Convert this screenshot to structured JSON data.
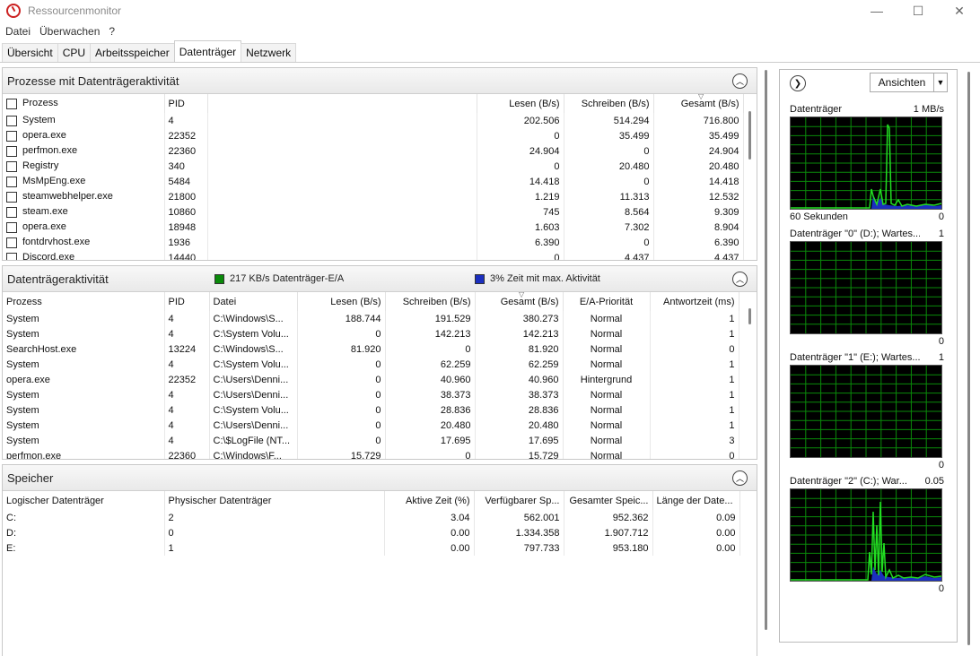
{
  "window": {
    "title": "Ressourcenmonitor",
    "minimize": "—",
    "maximize": "☐",
    "close": "✕"
  },
  "menu": [
    "Datei",
    "Überwachen",
    "?"
  ],
  "tabs": [
    "Übersicht",
    "CPU",
    "Arbeitsspeicher",
    "Datenträger",
    "Netzwerk"
  ],
  "active_tab": "Datenträger",
  "processes": {
    "title": "Prozesse mit Datenträgeraktivität",
    "columns": [
      "Prozess",
      "PID",
      "",
      "Lesen (B/s)",
      "Schreiben (B/s)",
      "Gesamt (B/s)"
    ],
    "rows": [
      [
        "System",
        "4",
        "202.506",
        "514.294",
        "716.800"
      ],
      [
        "opera.exe",
        "22352",
        "0",
        "35.499",
        "35.499"
      ],
      [
        "perfmon.exe",
        "22360",
        "24.904",
        "0",
        "24.904"
      ],
      [
        "Registry",
        "340",
        "0",
        "20.480",
        "20.480"
      ],
      [
        "MsMpEng.exe",
        "5484",
        "14.418",
        "0",
        "14.418"
      ],
      [
        "steamwebhelper.exe",
        "21800",
        "1.219",
        "11.313",
        "12.532"
      ],
      [
        "steam.exe",
        "10860",
        "745",
        "8.564",
        "9.309"
      ],
      [
        "opera.exe",
        "18948",
        "1.603",
        "7.302",
        "8.904"
      ],
      [
        "fontdrvhost.exe",
        "1936",
        "6.390",
        "0",
        "6.390"
      ],
      [
        "Discord.exe",
        "14440",
        "0",
        "4.437",
        "4.437"
      ]
    ]
  },
  "activity": {
    "title": "Datenträgeraktivität",
    "legend_io": "217 KB/s Datenträger-E/A",
    "legend_active": "3% Zeit mit max. Aktivität",
    "color_io": "#0a8a0a",
    "color_active": "#1b2fbf",
    "columns": [
      "Prozess",
      "PID",
      "Datei",
      "Lesen (B/s)",
      "Schreiben (B/s)",
      "Gesamt (B/s)",
      "E/A-Priorität",
      "Antwortzeit (ms)"
    ],
    "rows": [
      [
        "System",
        "4",
        "C:\\Windows\\S...",
        "188.744",
        "191.529",
        "380.273",
        "Normal",
        "1"
      ],
      [
        "System",
        "4",
        "C:\\System Volu...",
        "0",
        "142.213",
        "142.213",
        "Normal",
        "1"
      ],
      [
        "SearchHost.exe",
        "13224",
        "C:\\Windows\\S...",
        "81.920",
        "0",
        "81.920",
        "Normal",
        "0"
      ],
      [
        "System",
        "4",
        "C:\\System Volu...",
        "0",
        "62.259",
        "62.259",
        "Normal",
        "1"
      ],
      [
        "opera.exe",
        "22352",
        "C:\\Users\\Denni...",
        "0",
        "40.960",
        "40.960",
        "Hintergrund",
        "1"
      ],
      [
        "System",
        "4",
        "C:\\Users\\Denni...",
        "0",
        "38.373",
        "38.373",
        "Normal",
        "1"
      ],
      [
        "System",
        "4",
        "C:\\System Volu...",
        "0",
        "28.836",
        "28.836",
        "Normal",
        "1"
      ],
      [
        "System",
        "4",
        "C:\\Users\\Denni...",
        "0",
        "20.480",
        "20.480",
        "Normal",
        "1"
      ],
      [
        "System",
        "4",
        "C:\\$LogFile (NT...",
        "0",
        "17.695",
        "17.695",
        "Normal",
        "3"
      ],
      [
        "perfmon.exe",
        "22360",
        "C:\\Windows\\F...",
        "15.729",
        "0",
        "15.729",
        "Normal",
        "0"
      ]
    ]
  },
  "storage": {
    "title": "Speicher",
    "columns": [
      "Logischer Datenträger",
      "Physischer Datenträger",
      "Aktive Zeit (%)",
      "Verfügbarer Sp...",
      "Gesamter Speic...",
      "Länge der Date..."
    ],
    "rows": [
      [
        "C:",
        "2",
        "3.04",
        "562.001",
        "952.362",
        "0.09"
      ],
      [
        "D:",
        "0",
        "0.00",
        "1.334.358",
        "1.907.712",
        "0.00"
      ],
      [
        "E:",
        "1",
        "0.00",
        "797.733",
        "953.180",
        "0.00"
      ]
    ]
  },
  "right_panel": {
    "view_button": "Ansichten",
    "graphs": [
      {
        "label": "Datenträger",
        "scale": "1 MB/s",
        "bottom_left": "60 Sekunden",
        "bottom_right": "0",
        "activity": "high"
      },
      {
        "label": "Datenträger \"0\" (D:); Wartes...",
        "scale": "1",
        "bottom_left": "",
        "bottom_right": "0",
        "activity": "none"
      },
      {
        "label": "Datenträger \"1\" (E:); Wartes...",
        "scale": "1",
        "bottom_left": "",
        "bottom_right": "0",
        "activity": "none"
      },
      {
        "label": "Datenträger \"2\" (C:); War...",
        "scale": "0.05",
        "bottom_left": "",
        "bottom_right": "0",
        "activity": "high"
      }
    ],
    "grid_color": "#0a8a0a",
    "line_color": "#22dd22",
    "fill_color": "#1b2fbf"
  }
}
